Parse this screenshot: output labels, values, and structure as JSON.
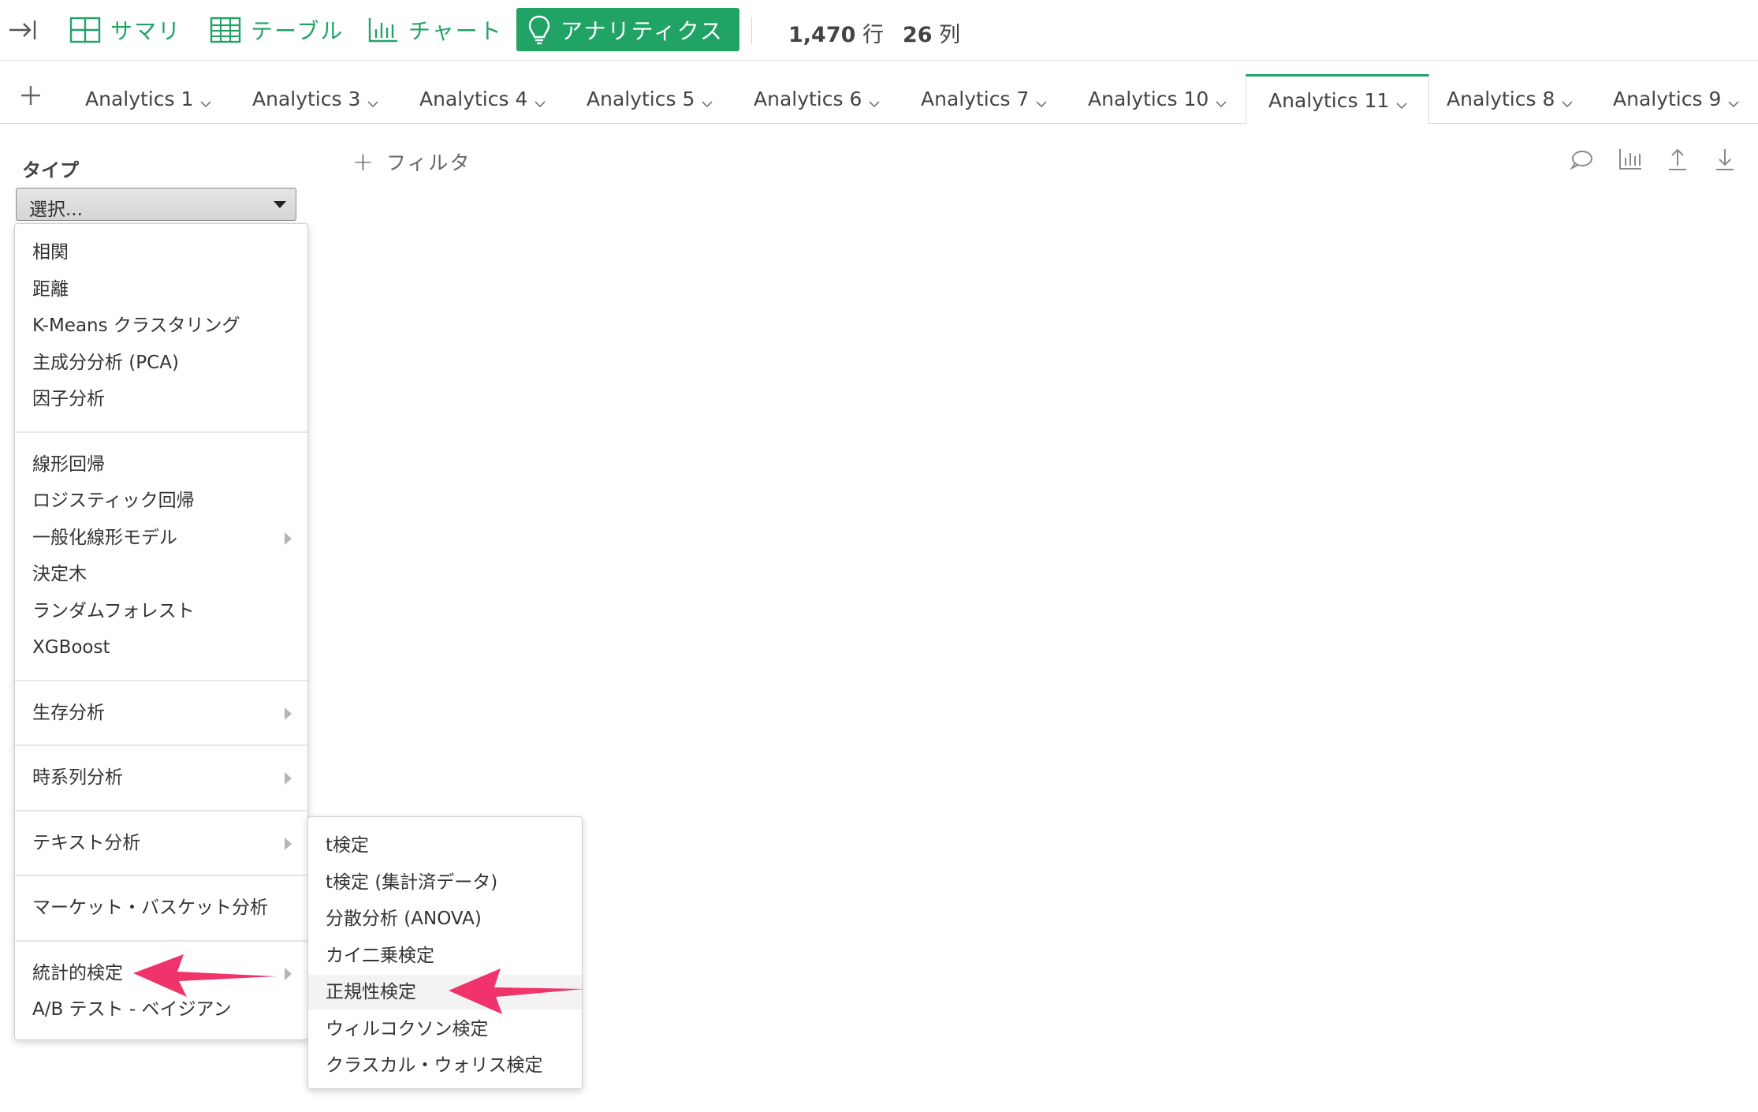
{
  "toolbar": {
    "views": [
      {
        "label": "サマリ",
        "icon": "summary-grid-icon"
      },
      {
        "label": "テーブル",
        "icon": "table-icon"
      },
      {
        "label": "チャート",
        "icon": "chart-icon"
      },
      {
        "label": "アナリティクス",
        "icon": "lightbulb-icon",
        "active": true
      }
    ],
    "rows_value": "1,470",
    "rows_unit": "行",
    "cols_value": "26",
    "cols_unit": "列"
  },
  "tabs": [
    "Analytics 1",
    "Analytics 3",
    "Analytics 4",
    "Analytics 5",
    "Analytics 6",
    "Analytics 7",
    "Analytics 10",
    "Analytics 11",
    "Analytics 8",
    "Analytics 9"
  ],
  "active_tab": "Analytics 11",
  "panel": {
    "type_label": "タイプ",
    "select_value": "選択...",
    "filter_label": "フィルタ"
  },
  "type_menu": {
    "groups": [
      [
        "相関",
        "距離",
        "K-Means クラスタリング",
        "主成分分析 (PCA)",
        "因子分析"
      ],
      [
        "線形回帰",
        "ロジスティック回帰",
        "一般化線形モデル",
        "決定木",
        "ランダムフォレスト",
        "XGBoost"
      ],
      [
        "生存分析"
      ],
      [
        "時系列分析"
      ],
      [
        "テキスト分析"
      ],
      [
        "マーケット・バスケット分析"
      ],
      [
        "統計的検定",
        "A/B テスト - ベイジアン"
      ]
    ]
  },
  "stat_test_menu": [
    "t検定",
    "t検定 (集計済データ)",
    "分散分析 (ANOVA)",
    "カイ二乗検定",
    "正規性検定",
    "ウィルコクソン検定",
    "クラスカル・ウォリス検定"
  ],
  "colors": {
    "accent": "#21a366",
    "annotation_arrow": "#f0336b"
  }
}
